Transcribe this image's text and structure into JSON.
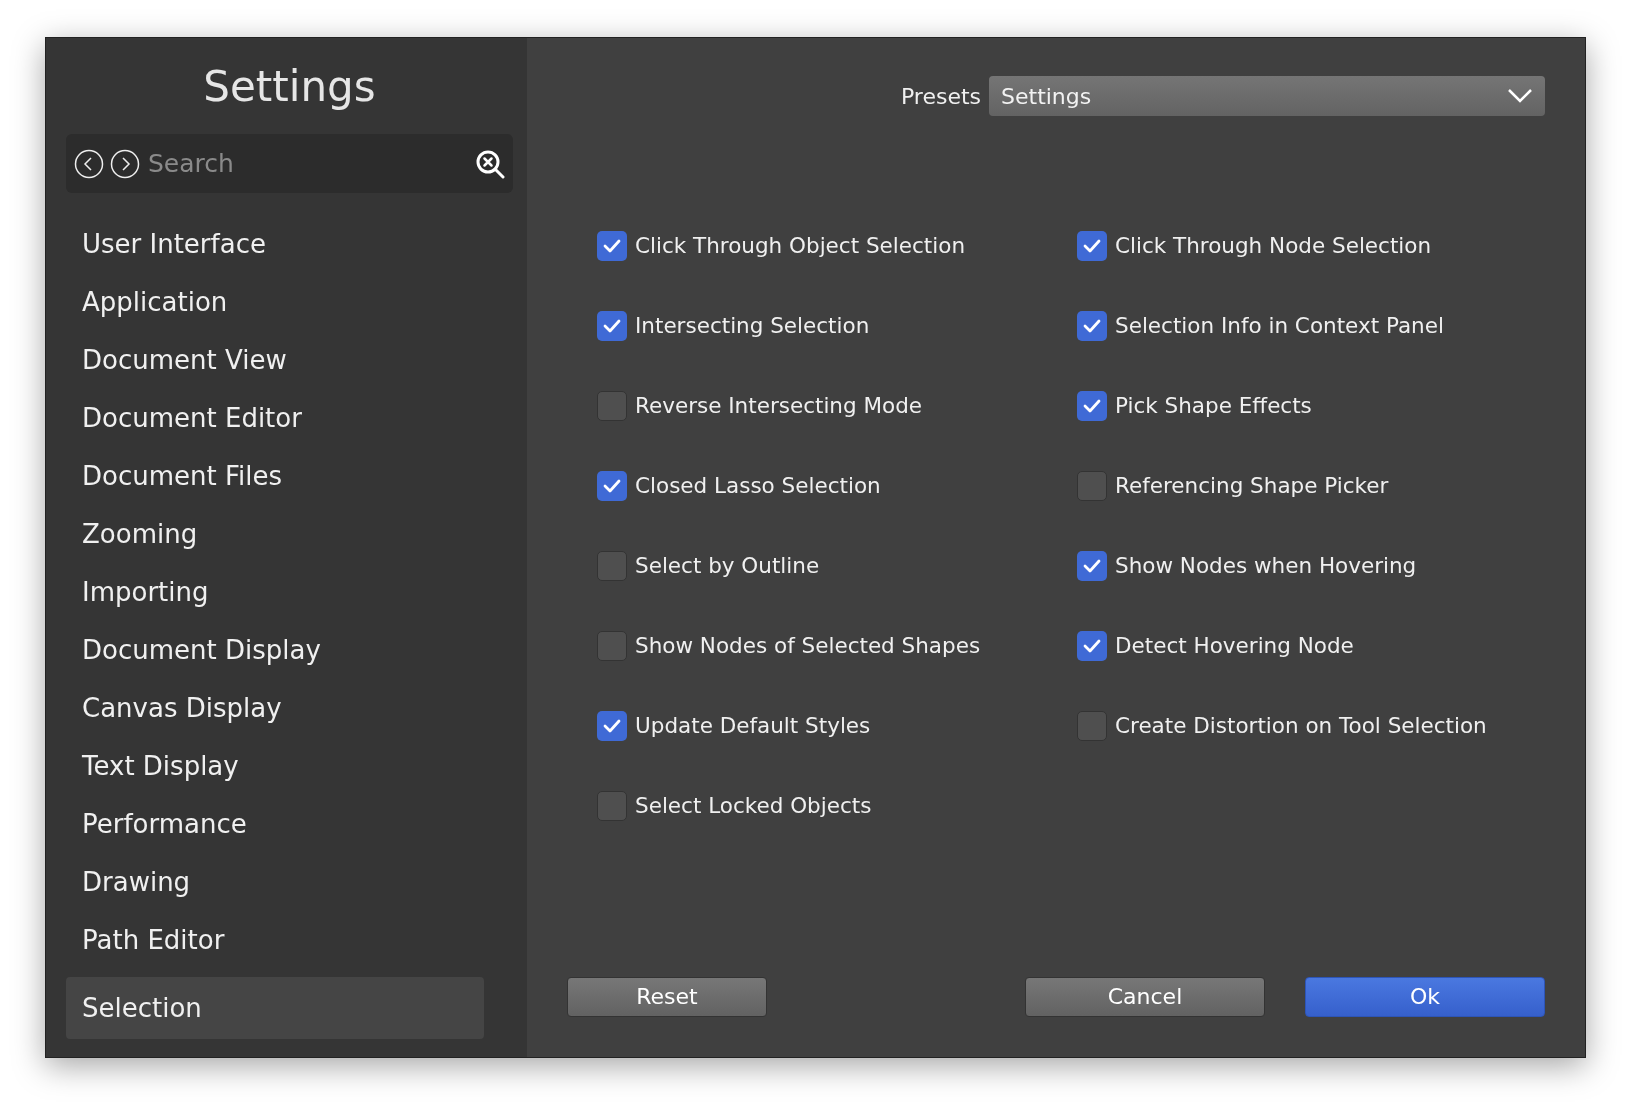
{
  "sidebar": {
    "title": "Settings",
    "search": {
      "placeholder": "Search"
    },
    "items": [
      {
        "label": "User Interface",
        "selected": false
      },
      {
        "label": "Application",
        "selected": false
      },
      {
        "label": "Document View",
        "selected": false
      },
      {
        "label": "Document Editor",
        "selected": false
      },
      {
        "label": "Document Files",
        "selected": false
      },
      {
        "label": "Zooming",
        "selected": false
      },
      {
        "label": "Importing",
        "selected": false
      },
      {
        "label": "Document Display",
        "selected": false
      },
      {
        "label": "Canvas Display",
        "selected": false
      },
      {
        "label": "Text Display",
        "selected": false
      },
      {
        "label": "Performance",
        "selected": false
      },
      {
        "label": "Drawing",
        "selected": false
      },
      {
        "label": "Path Editor",
        "selected": false
      },
      {
        "label": "Selection",
        "selected": true
      }
    ]
  },
  "presets": {
    "label": "Presets",
    "value": "Settings"
  },
  "options": [
    {
      "label": "Click Through Object Selection",
      "checked": true
    },
    {
      "label": "Click Through Node Selection",
      "checked": true
    },
    {
      "label": "Intersecting Selection",
      "checked": true
    },
    {
      "label": "Selection Info in Context Panel",
      "checked": true
    },
    {
      "label": "Reverse Intersecting Mode",
      "checked": false
    },
    {
      "label": "Pick Shape Effects",
      "checked": true
    },
    {
      "label": "Closed Lasso Selection",
      "checked": true
    },
    {
      "label": "Referencing Shape Picker",
      "checked": false
    },
    {
      "label": "Select by Outline",
      "checked": false
    },
    {
      "label": "Show Nodes when Hovering",
      "checked": true
    },
    {
      "label": "Show Nodes of Selected Shapes",
      "checked": false
    },
    {
      "label": "Detect Hovering Node",
      "checked": true
    },
    {
      "label": "Update Default Styles",
      "checked": true
    },
    {
      "label": "Create Distortion on Tool Selection",
      "checked": false
    },
    {
      "label": "Select Locked Objects",
      "checked": false
    }
  ],
  "buttons": [
    {
      "label": "Reset",
      "kind": "plain"
    },
    {
      "label": "Cancel",
      "kind": "plain"
    },
    {
      "label": "Ok",
      "kind": "primary"
    }
  ]
}
